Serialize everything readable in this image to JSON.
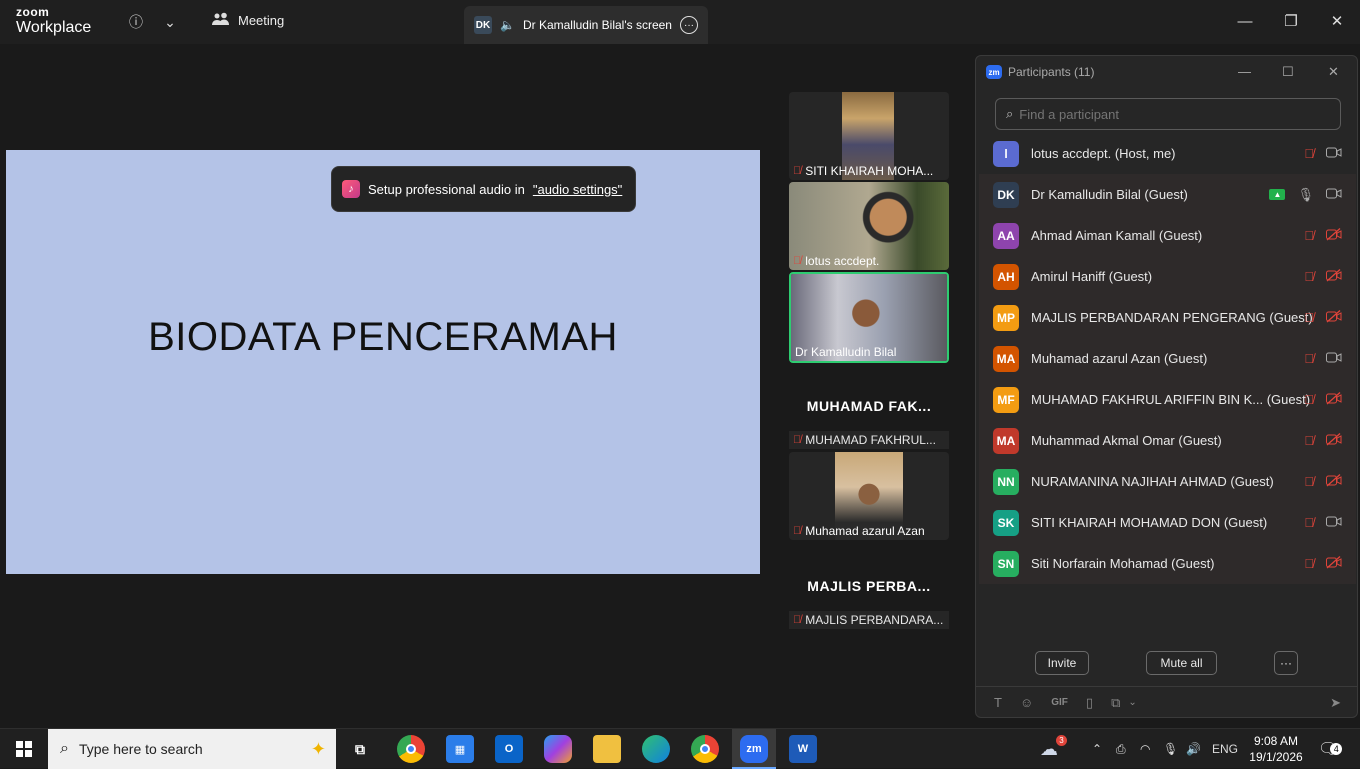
{
  "titlebar": {
    "brand_top": "zoom",
    "brand_bottom": "Workplace",
    "meeting_label": "Meeting",
    "share_badge": "DK",
    "share_label": "Dr Kamalludin Bilal's screen"
  },
  "slide": {
    "title": "BIODATA PENCERAMAH"
  },
  "toast": {
    "text": "Setup professional audio in",
    "link": "\"audio settings\""
  },
  "tiles": [
    {
      "name": "SITI KHAIRAH MOHA..."
    },
    {
      "name": "lotus accdept."
    },
    {
      "name": "Dr Kamalludin Bilal"
    },
    {
      "big": "MUHAMAD FAK...",
      "name": "MUHAMAD FAKHRUL..."
    },
    {
      "name": "Muhamad azarul Azan"
    },
    {
      "big": "MAJLIS PERBA...",
      "name": "MAJLIS PERBANDARA..."
    }
  ],
  "panel": {
    "title": "Participants (11)",
    "search_placeholder": "Find a participant",
    "participants": [
      {
        "initials": "l",
        "name": "lotus accdept. (Host, me)",
        "color": "#5b6bd1",
        "mic": "off",
        "cam": "on"
      },
      {
        "initials": "DK",
        "name": "Dr Kamalludin Bilal (Guest)",
        "color": "#2f3e52",
        "mic": "on",
        "cam": "on",
        "sharing": true
      },
      {
        "initials": "AA",
        "name": "Ahmad Aiman Kamall (Guest)",
        "color": "#8e44ad",
        "mic": "off",
        "cam": "off"
      },
      {
        "initials": "AH",
        "name": "Amirul Haniff (Guest)",
        "color": "#d35400",
        "mic": "off",
        "cam": "off"
      },
      {
        "initials": "MP",
        "name": "MAJLIS PERBANDARAN PENGERANG (Guest)",
        "color": "#f39c12",
        "mic": "off",
        "cam": "off"
      },
      {
        "initials": "MA",
        "name": "Muhamad azarul Azan (Guest)",
        "color": "#d35400",
        "mic": "off",
        "cam": "on"
      },
      {
        "initials": "MF",
        "name": "MUHAMAD FAKHRUL ARIFFIN BIN K...  (Guest)",
        "color": "#f39c12",
        "mic": "off",
        "cam": "off"
      },
      {
        "initials": "MA",
        "name": "Muhammad Akmal Omar (Guest)",
        "color": "#c0392b",
        "mic": "off",
        "cam": "off"
      },
      {
        "initials": "NN",
        "name": "NURAMANINA NAJIHAH AHMAD (Guest)",
        "color": "#27ae60",
        "mic": "off",
        "cam": "off"
      },
      {
        "initials": "SK",
        "name": "SITI KHAIRAH MOHAMAD DON (Guest)",
        "color": "#16a085",
        "mic": "off",
        "cam": "on"
      },
      {
        "initials": "SN",
        "name": "Siti Norfarain Mohamad (Guest)",
        "color": "#27ae60",
        "mic": "off",
        "cam": "off"
      }
    ],
    "invite_label": "Invite",
    "mute_all_label": "Mute all",
    "more_label": "···",
    "gif_label": "GIF"
  },
  "taskbar": {
    "search_placeholder": "Type here to search",
    "zoom_label": "zm",
    "weather_badge": "3",
    "lang": "ENG",
    "time": "9:08 AM",
    "date": "19/1/2026",
    "notif_count": "4"
  }
}
